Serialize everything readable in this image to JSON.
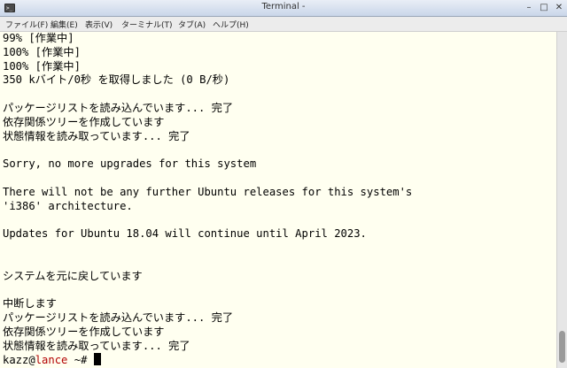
{
  "window": {
    "title": "Terminal -"
  },
  "menu": [
    "ファイル(F)",
    "編集(E)",
    "表示(V)",
    "ターミナル(T)",
    "タブ(A)",
    "ヘルプ(H)"
  ],
  "terminal_lines": [
    "99% [作業中]",
    "100% [作業中]",
    "100% [作業中]",
    "350 kバイト/0秒 を取得しました (0 B/秒)",
    "",
    "パッケージリストを読み込んでいます... 完了",
    "依存関係ツリーを作成しています",
    "状態情報を読み取っています... 完了",
    "",
    "Sorry, no more upgrades for this system",
    "",
    "There will not be any further Ubuntu releases for this system's",
    "'i386' architecture.",
    "",
    "Updates for Ubuntu 18.04 will continue until April 2023.",
    "",
    "",
    "システムを元に戻しています",
    "",
    "中断します",
    "パッケージリストを読み込んでいます... 完了",
    "依存関係ツリーを作成しています",
    "状態情報を読み取っています... 完了"
  ],
  "prompt": {
    "user": "kazz",
    "at": "@",
    "host": "lance",
    "path": " ~#"
  },
  "colors": {
    "terminal_bg": "#fffff0",
    "prompt_host": "#b30000"
  }
}
